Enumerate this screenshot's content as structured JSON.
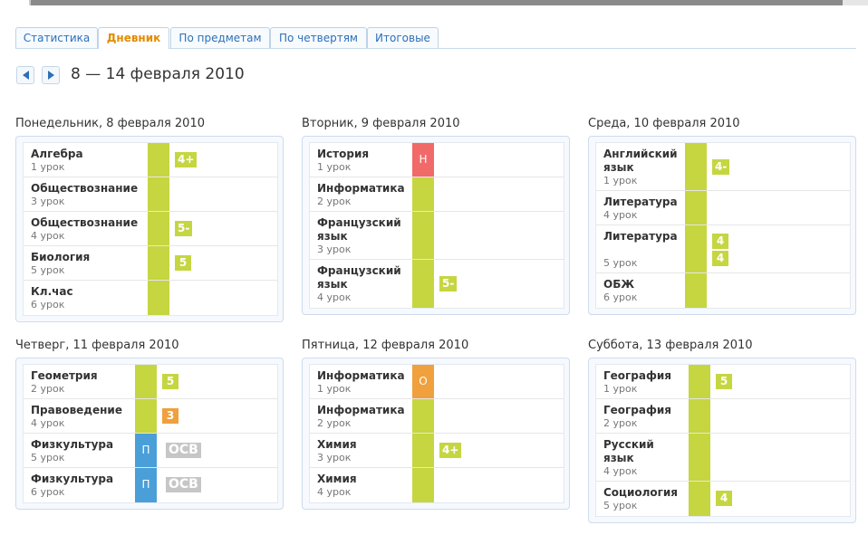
{
  "tabs": [
    "Статистика",
    "Дневник",
    "По предметам",
    "По четвертям",
    "Итоговые"
  ],
  "active_tab": "Дневник",
  "week_title": "8 — 14 февраля 2010",
  "colors": {
    "green": "#c5d641",
    "red": "#f06a6a",
    "orange": "#f0a03c",
    "blue": "#4a9fd8",
    "gray": "#c6c6c6",
    "link": "#2b70b8",
    "active_tab": "#e28c00"
  },
  "days": [
    {
      "title": "Понедельник, 8 февраля 2010",
      "lessons": [
        {
          "subject": "Алгебра",
          "lesson": "1 урок",
          "marks": [
            "4+"
          ]
        },
        {
          "subject": "Обществознание",
          "lesson": "3 урок",
          "marks": []
        },
        {
          "subject": "Обществознание",
          "lesson": "4 урок",
          "marks": [
            "5-"
          ]
        },
        {
          "subject": "Биология",
          "lesson": "5 урок",
          "marks": [
            "5"
          ]
        },
        {
          "subject": "Кл.час",
          "lesson": "6 урок",
          "marks": []
        }
      ]
    },
    {
      "title": "Вторник, 9 февраля 2010",
      "lessons": [
        {
          "subject": "История",
          "lesson": "1 урок",
          "status": "Н",
          "marks": []
        },
        {
          "subject": "Информатика",
          "lesson": "2 урок",
          "marks": []
        },
        {
          "subject": "Французский язык",
          "lesson": "3 урок",
          "marks": []
        },
        {
          "subject": "Французский язык",
          "lesson": "4 урок",
          "marks": [
            "5-"
          ]
        }
      ]
    },
    {
      "title": "Среда, 10 февраля 2010",
      "lessons": [
        {
          "subject": "Английский язык",
          "lesson": "1 урок",
          "marks": [
            "4-"
          ]
        },
        {
          "subject": "Литература",
          "lesson": "4 урок",
          "marks": []
        },
        {
          "subject": "Литература",
          "lesson": "5 урок",
          "marks": [
            "4",
            "4"
          ]
        },
        {
          "subject": "ОБЖ",
          "lesson": "6 урок",
          "marks": []
        }
      ]
    },
    {
      "title": "Четверг, 11 февраля 2010",
      "lessons": [
        {
          "subject": "Геометрия",
          "lesson": "2 урок",
          "marks": [
            "5"
          ]
        },
        {
          "subject": "Правоведение",
          "lesson": "4 урок",
          "marks": [
            "3"
          ]
        },
        {
          "subject": "Физкультура",
          "lesson": "5 урок",
          "status": "П",
          "marks": [
            "ОСВ"
          ]
        },
        {
          "subject": "Физкультура",
          "lesson": "6 урок",
          "status": "П",
          "marks": [
            "ОСВ"
          ]
        }
      ]
    },
    {
      "title": "Пятница, 12 февраля 2010",
      "lessons": [
        {
          "subject": "Информатика",
          "lesson": "1 урок",
          "status": "О",
          "marks": []
        },
        {
          "subject": "Информатика",
          "lesson": "2 урок",
          "marks": []
        },
        {
          "subject": "Химия",
          "lesson": "3 урок",
          "marks": [
            "4+"
          ]
        },
        {
          "subject": "Химия",
          "lesson": "4 урок",
          "marks": []
        }
      ]
    },
    {
      "title": "Суббота, 13 февраля 2010",
      "lessons": [
        {
          "subject": "География",
          "lesson": "1 урок",
          "marks": [
            "5"
          ]
        },
        {
          "subject": "География",
          "lesson": "2 урок",
          "marks": []
        },
        {
          "subject": "Русский язык",
          "lesson": "4 урок",
          "marks": []
        },
        {
          "subject": "Социология",
          "lesson": "5 урок",
          "marks": [
            "4"
          ]
        }
      ]
    }
  ]
}
